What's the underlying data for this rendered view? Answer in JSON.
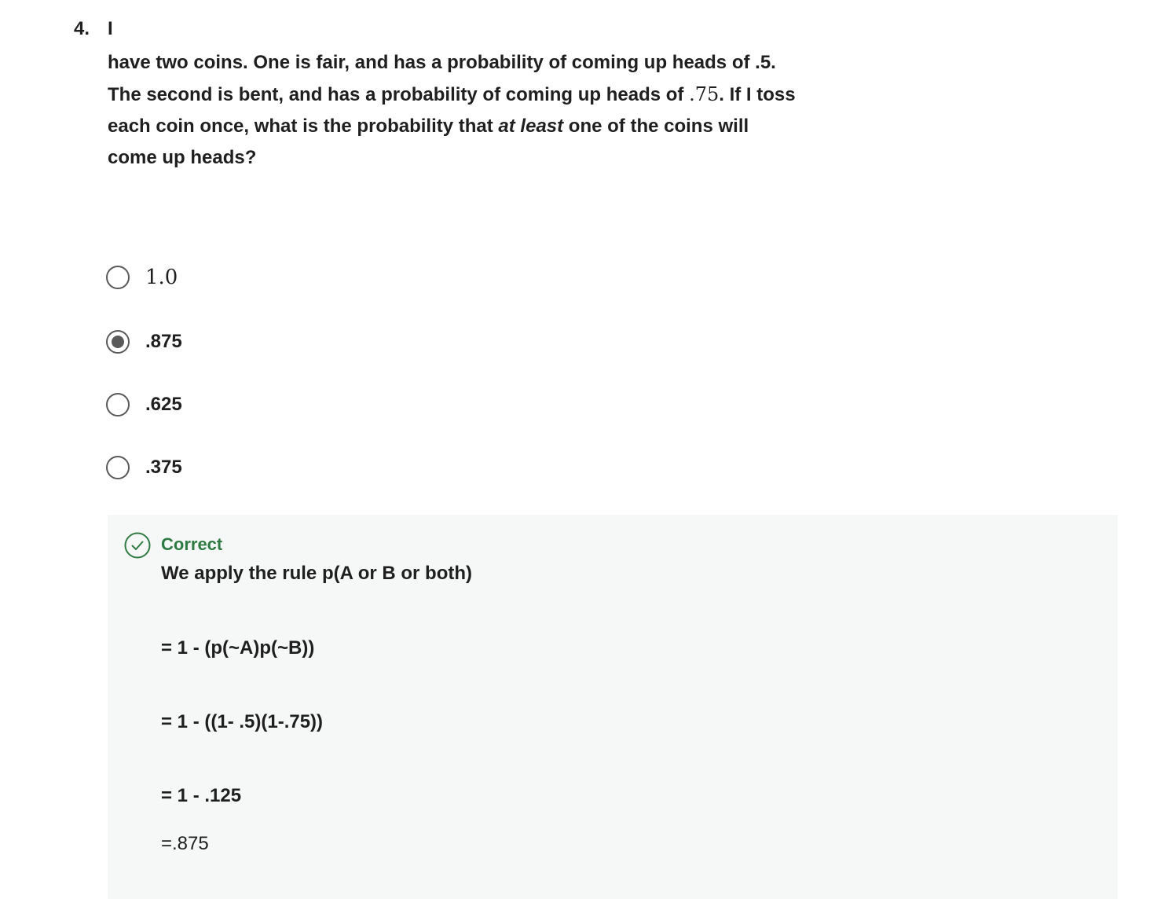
{
  "question": {
    "number": "4.",
    "lead": "I",
    "line1": "have two coins. One is fair, and has a probability of coming up heads of .5.",
    "line2_pre": "The second is bent, and has a probability of coming up heads of ",
    "line2_math": ".75",
    "line2_post": ". If I toss",
    "line3_pre": "each coin once, what is the probability that ",
    "line3_em": "at least",
    "line3_post": " one of the coins will",
    "line4": "come up heads?"
  },
  "options": [
    {
      "label": "1.0",
      "selected": false
    },
    {
      "label": ".875",
      "selected": true
    },
    {
      "label": ".625",
      "selected": false
    },
    {
      "label": ".375",
      "selected": false
    }
  ],
  "feedback": {
    "status": "Correct",
    "status_color": "#2f7a43",
    "lines": [
      "We apply the rule p(A or B or both)",
      "= 1 - (p(~A)p(~B))",
      "= 1 - ((1- .5)(1-.75))",
      "= 1 - .125",
      "=.875"
    ]
  }
}
